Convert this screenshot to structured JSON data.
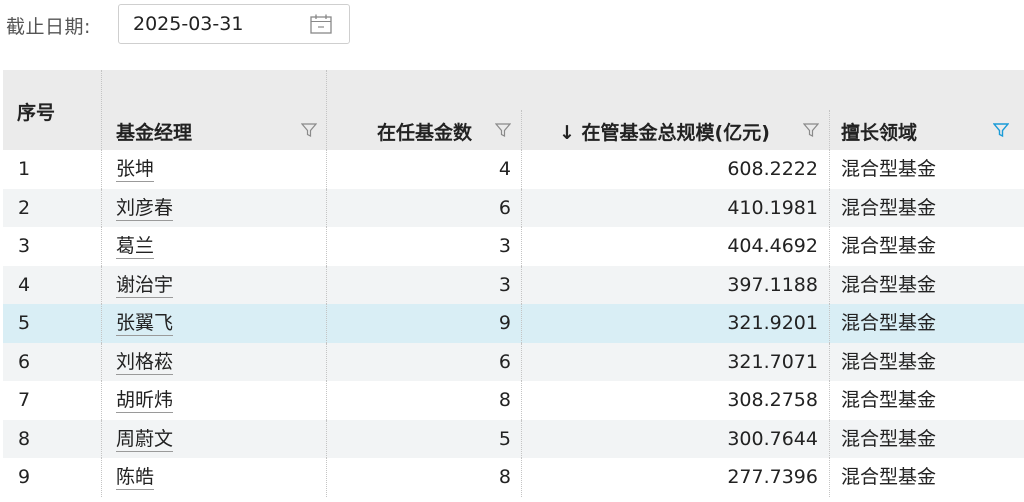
{
  "filter": {
    "label": "截止日期:",
    "date_value": "2025-03-31",
    "calendar_icon": "calendar-icon"
  },
  "table": {
    "headers": {
      "index": "序号",
      "manager": "基金经理",
      "fund_count": "在任基金数",
      "aum": "↓ 在管基金总规模(亿元)",
      "specialty": "擅长领域"
    },
    "active_filter_color": "#1a9bd7",
    "highlight_row_color": "#d9eef5",
    "rows": [
      {
        "index": "1",
        "manager": "张坤",
        "fund_count": "4",
        "aum": "608.2222",
        "specialty": "混合型基金"
      },
      {
        "index": "2",
        "manager": "刘彦春",
        "fund_count": "6",
        "aum": "410.1981",
        "specialty": "混合型基金"
      },
      {
        "index": "3",
        "manager": "葛兰",
        "fund_count": "3",
        "aum": "404.4692",
        "specialty": "混合型基金"
      },
      {
        "index": "4",
        "manager": "谢治宇",
        "fund_count": "3",
        "aum": "397.1188",
        "specialty": "混合型基金"
      },
      {
        "index": "5",
        "manager": "张翼飞",
        "fund_count": "9",
        "aum": "321.9201",
        "specialty": "混合型基金"
      },
      {
        "index": "6",
        "manager": "刘格菘",
        "fund_count": "6",
        "aum": "321.7071",
        "specialty": "混合型基金"
      },
      {
        "index": "7",
        "manager": "胡昕炜",
        "fund_count": "8",
        "aum": "308.2758",
        "specialty": "混合型基金"
      },
      {
        "index": "8",
        "manager": "周蔚文",
        "fund_count": "5",
        "aum": "300.7644",
        "specialty": "混合型基金"
      },
      {
        "index": "9",
        "manager": "陈皓",
        "fund_count": "8",
        "aum": "277.7396",
        "specialty": "混合型基金"
      }
    ]
  }
}
